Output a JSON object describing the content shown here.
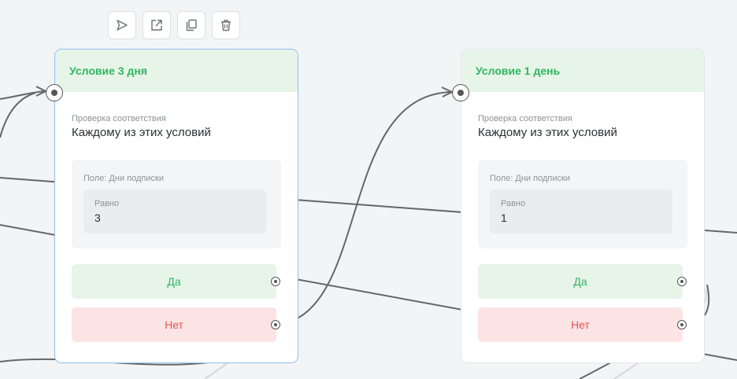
{
  "toolbar": {
    "buttons": [
      {
        "icon": "send-icon"
      },
      {
        "icon": "external-link-icon"
      },
      {
        "icon": "copy-icon"
      },
      {
        "icon": "trash-icon"
      }
    ]
  },
  "nodes": [
    {
      "title": "Условие 3 дня",
      "match_label": "Проверка соответствия",
      "match_value": "Каждому из этих условий",
      "field_label": "Поле: Дни подписки",
      "operator_label": "Равно",
      "operator_value": "3",
      "yes_label": "Да",
      "no_label": "Нет",
      "selected": true
    },
    {
      "title": "Условие 1 день",
      "match_label": "Проверка соответствия",
      "match_value": "Каждому из этих условий",
      "field_label": "Поле: Дни подписки",
      "operator_label": "Равно",
      "operator_value": "1",
      "yes_label": "Да",
      "no_label": "Нет",
      "selected": false
    }
  ],
  "colors": {
    "canvas": "#f3f4f6",
    "header_bg": "#e6f5e8",
    "header_text": "#2fb761",
    "yes_bg": "#e6f5e8",
    "yes_text": "#2fb761",
    "no_bg": "#fde4e4",
    "no_text": "#e7534f",
    "selected_border": "#8fc0ef",
    "wire": "#666666"
  }
}
